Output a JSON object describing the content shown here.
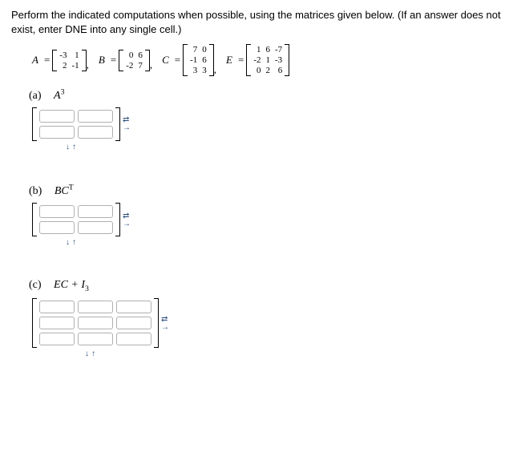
{
  "instructions": "Perform the indicated computations when possible, using the matrices given below. (If an answer does not exist, enter DNE into any single cell.)",
  "matrices": {
    "A": {
      "label": "A",
      "rows": [
        [
          "-3",
          "1"
        ],
        [
          "2",
          "-1"
        ]
      ]
    },
    "B": {
      "label": "B",
      "rows": [
        [
          "0",
          "6"
        ],
        [
          "-2",
          "7"
        ]
      ]
    },
    "C": {
      "label": "C",
      "rows": [
        [
          "7",
          "0"
        ],
        [
          "-1",
          "6"
        ],
        [
          "3",
          "3"
        ]
      ]
    },
    "E": {
      "label": "E",
      "rows": [
        [
          "1",
          "6",
          "-7"
        ],
        [
          "-2",
          "1",
          "-3"
        ],
        [
          "0",
          "2",
          "6"
        ]
      ]
    }
  },
  "parts": {
    "a": {
      "letter": "(a)",
      "expr_html": "A<sup>3</sup>"
    },
    "b": {
      "letter": "(b)",
      "expr_html": "BC<sup>T</sup>"
    },
    "c": {
      "letter": "(c)",
      "expr_html": "EC + I<sub>3</sub>"
    }
  },
  "glyphs": {
    "eq": "=",
    "comma": ",",
    "arrow_up_down": "⇅",
    "arrow_left_right": "⇄",
    "arrow_down": "↓",
    "arrow_up": "↑",
    "arrow_right": "→",
    "arrow_left": "←"
  }
}
